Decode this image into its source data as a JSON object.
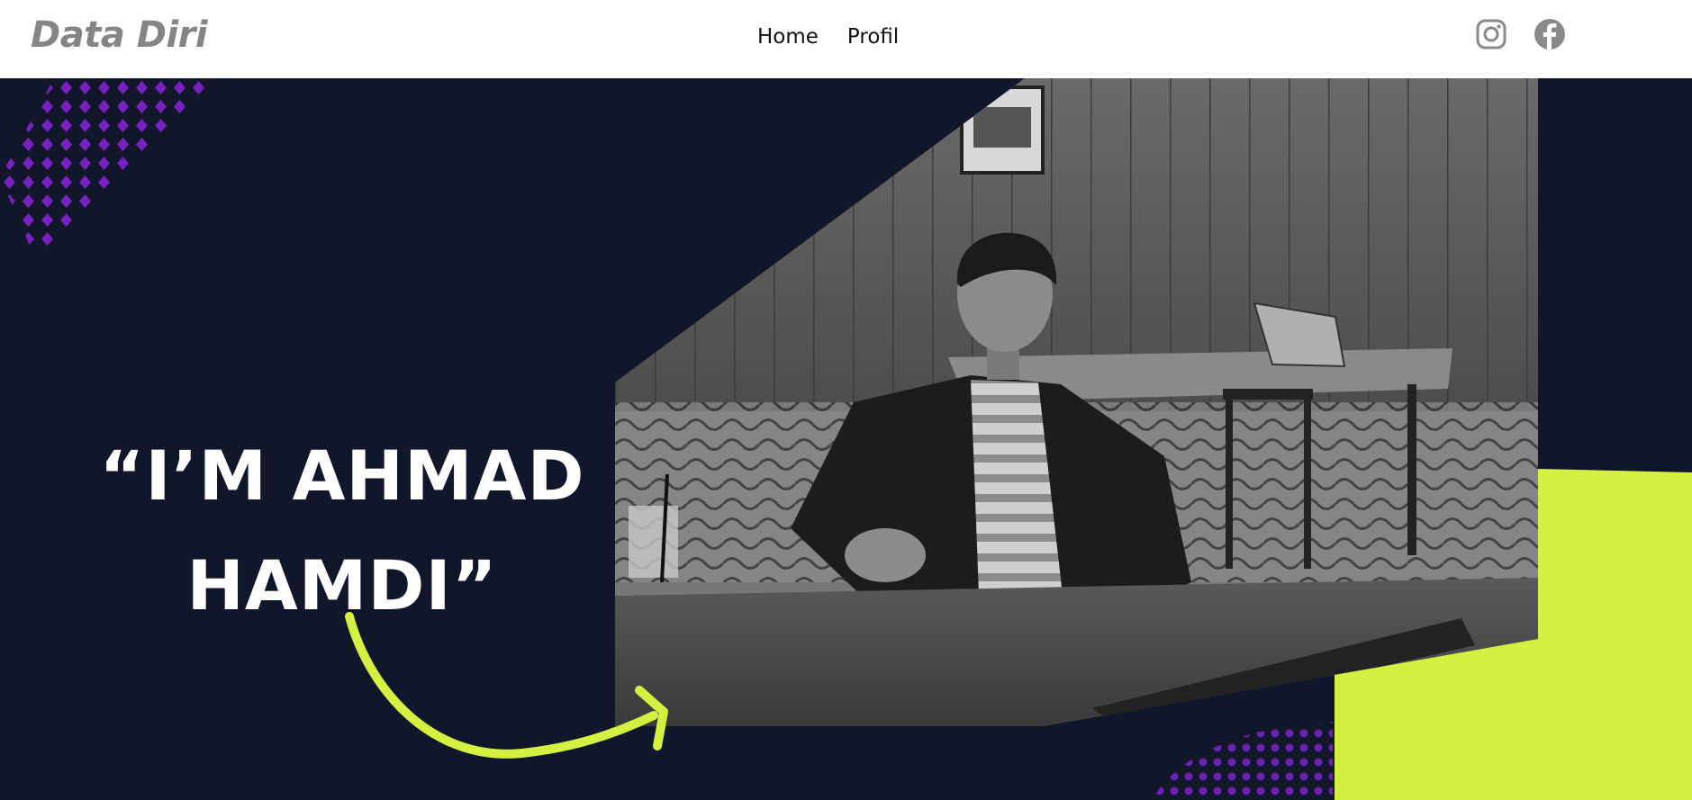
{
  "navbar": {
    "brand": "Data Diri",
    "links": [
      {
        "label": "Home"
      },
      {
        "label": "Profil"
      }
    ],
    "social": [
      {
        "icon": "instagram-icon"
      },
      {
        "icon": "facebook-icon"
      }
    ]
  },
  "hero": {
    "title_line1": "“I’M AHMAD",
    "title_line2": "HAMDI”"
  },
  "colors": {
    "navy": "#12162b",
    "lime": "#d4f142",
    "purple": "#7b22c8",
    "icon_gray": "#8a8a8a"
  }
}
